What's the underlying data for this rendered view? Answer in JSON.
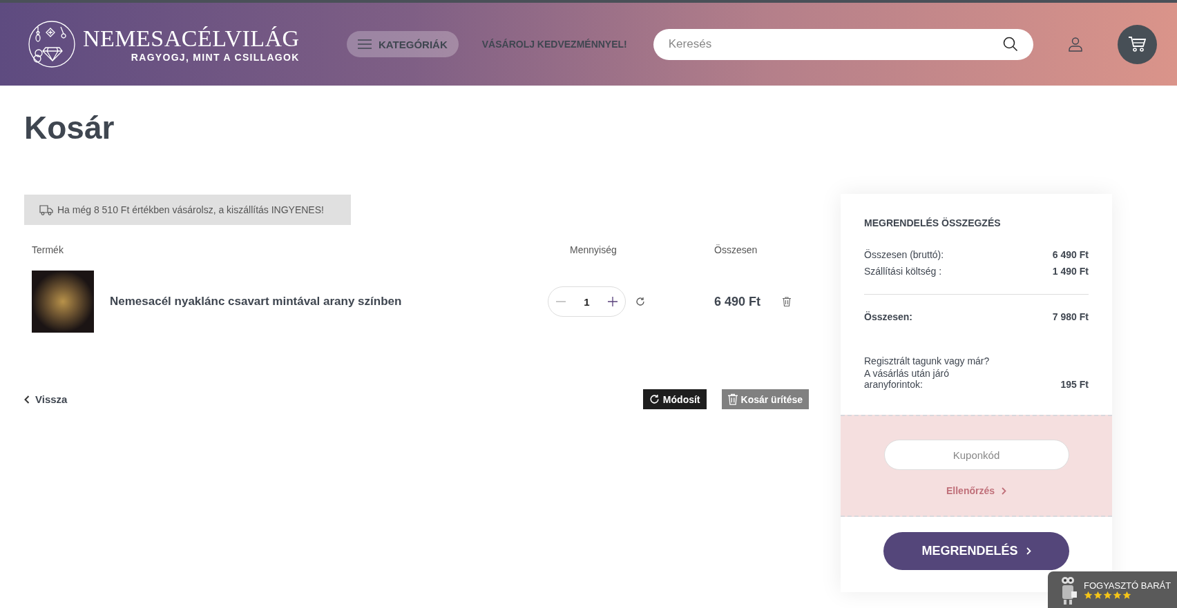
{
  "header": {
    "logo": {
      "title": "NEMESACÉLVILÁG",
      "tagline": "RAGYOGJ, MINT A CSILLAGOK"
    },
    "categories_button": "KATEGÓRIÁK",
    "promo_link": "VÁSÁROLJ KEDVEZMÉNNYEL!",
    "search": {
      "placeholder": "Keresés"
    }
  },
  "page_title": "Kosár",
  "shipping_notice": "Ha még 8 510 Ft értékben vásárolsz, a kiszállítás INGYENES!",
  "cart": {
    "columns": [
      "Termék",
      "Mennyiség",
      "Összesen"
    ],
    "items": [
      {
        "name": "Nemesacél nyaklánc csavart mintával arany színben",
        "quantity": "1",
        "total": "6 490 Ft"
      }
    ]
  },
  "back_link": "Vissza",
  "update_button": "Módosít",
  "empty_button": "Kosár ürítése",
  "summary": {
    "title": "MEGRENDELÉS ÖSSZEGZÉS",
    "rows": [
      {
        "label": "Összesen (bruttó):",
        "value": "6 490 Ft"
      },
      {
        "label": "Szállítási költség :",
        "value": "1 490 Ft"
      }
    ],
    "total": {
      "label": "Összesen:",
      "value": "7 980 Ft"
    },
    "loyalty": {
      "question": "Regisztrált tagunk vagy már?",
      "label": "A vásárlás után járó aranyforintok:",
      "value": "195 Ft"
    },
    "coupon": {
      "placeholder": "Kuponkód",
      "check_link": "Ellenőrzés"
    },
    "order_button": "MEGRENDELÉS"
  },
  "trust_badge": {
    "label": "FOGYASZTÓ BARÁT",
    "stars": 5
  }
}
